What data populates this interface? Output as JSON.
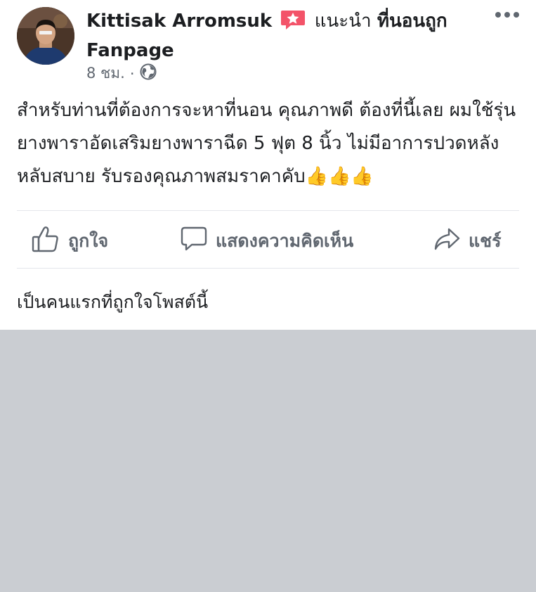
{
  "post": {
    "author": "Kittisak Arromsuk",
    "verb": "แนะนำ",
    "target": "ที่นอนถูก Fanpage",
    "time": "8 ชม.",
    "separator": "·",
    "body": "สำหรับท่านที่ต้องการจะหาที่นอน คุณภาพดี ต้องที่นี้เลย ผมใช้รุ่นยางพาราอัดเสริมยางพาราฉีด 5 ฟุต 8 นิ้ว ไม่มีอาการปวดหลัง หลับสบาย รับรองคุณภาพสมราคาคับ",
    "emoji": "👍👍👍"
  },
  "actions": {
    "like": "ถูกใจ",
    "comment": "แสดงความคิดเห็น",
    "share": "แชร์"
  },
  "footer": {
    "first_like_text": "เป็นคนแรกที่ถูกใจโพสต์นี้"
  },
  "colors": {
    "text": "#1c1e21",
    "muted": "#606770",
    "divider": "#e4e6eb",
    "background_gray": "#cacdd2",
    "badge_pink": "#f35369"
  },
  "icons": {
    "recommend_badge": "star-speech-bubble-icon",
    "privacy": "globe-icon",
    "more": "more-options-icon",
    "like": "thumbs-up-icon",
    "comment": "comment-bubble-icon",
    "share": "share-arrow-icon"
  }
}
